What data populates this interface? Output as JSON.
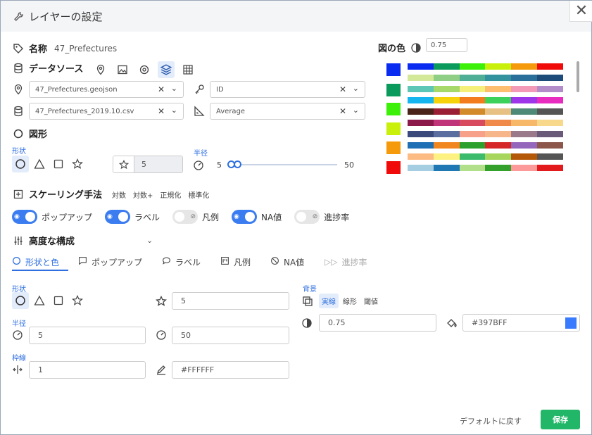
{
  "title": "レイヤーの設定",
  "name": {
    "label": "名称",
    "value": "47_Prefectures"
  },
  "datasource": {
    "label": "データソース"
  },
  "geo_select": {
    "value": "47_Prefectures.geojson"
  },
  "key_select": {
    "value": "ID"
  },
  "csv_select": {
    "value": "47_Prefectures_2019.10.csv"
  },
  "measure_select": {
    "value": "Average"
  },
  "shape_section": {
    "label": "図形",
    "shape_label": "形状",
    "radius_label": "半径",
    "star_value": "5",
    "radius_min": "5",
    "radius_max": "50"
  },
  "scaling": {
    "label": "スケーリング手法",
    "options": [
      "対数",
      "対数+",
      "正規化",
      "標準化"
    ]
  },
  "toggles": [
    {
      "label": "ポップアップ",
      "on": true
    },
    {
      "label": "ラベル",
      "on": true
    },
    {
      "label": "凡例",
      "on": false
    },
    {
      "label": "NA値",
      "on": true
    },
    {
      "label": "進捗率",
      "on": false
    }
  ],
  "advanced": {
    "label": "高度な構成"
  },
  "tabs": [
    {
      "label": "形状と色"
    },
    {
      "label": "ポップアップ"
    },
    {
      "label": "ラベル"
    },
    {
      "label": "凡例"
    },
    {
      "label": "NA値"
    },
    {
      "label": "進捗率"
    }
  ],
  "detail": {
    "shape_label": "形状",
    "star_value": "5",
    "radius_label": "半径",
    "radius_min": "5",
    "radius_max": "50",
    "border_label": "枠線",
    "border_width": "1",
    "border_color": "#FFFFFF",
    "background_label": "背景",
    "bg_options": [
      "実線",
      "線形",
      "閾値"
    ],
    "opacity": "0.75",
    "fill_color": "#397BFF"
  },
  "colors_panel": {
    "label": "図の色",
    "opacity": "0.75",
    "selected_swatches": [
      "#0a2bf0",
      "#0a9a5c",
      "#3cf00a",
      "#c8f00a",
      "#f59a0a",
      "#f00a0a"
    ],
    "palettes": [
      [
        "#0a2bf0",
        "#0a9a5c",
        "#3cf00a",
        "#c8f00a",
        "#f59a0a",
        "#f00a0a"
      ],
      [
        "#d4e89a",
        "#8fcf85",
        "#4fae96",
        "#32939f",
        "#2a6f9b",
        "#1d4b7a"
      ],
      [
        "#5cc7b7",
        "#a6d96a",
        "#f6f07a",
        "#fdbf6f",
        "#f49ab9",
        "#b28dc9"
      ],
      [
        "#15b6f0",
        "#f5d20a",
        "#f37c1e",
        "#3cd15a",
        "#9d35e8",
        "#e82cc0"
      ],
      [
        "#4a2418",
        "#9b1f34",
        "#d28a2a",
        "#e6c183",
        "#4f8a78",
        "#555555"
      ],
      [
        "#8b1a4a",
        "#c0347a",
        "#d84a5e",
        "#ef8a4a",
        "#f7b86a",
        "#f8d88a"
      ],
      [
        "#3a4a7a",
        "#5a6fa0",
        "#f7a08a",
        "#f7b58a",
        "#9a7a8a",
        "#6a5a7a"
      ],
      [
        "#1f6fb4",
        "#f2861e",
        "#2ca02c",
        "#d62728",
        "#9467bd",
        "#8c564b"
      ],
      [
        "#fdbb84",
        "#fdf281",
        "#3dbb6c",
        "#a6d65b",
        "#b35806",
        "#555555"
      ],
      [
        "#a6cee3",
        "#1f78b4",
        "#b2df8a",
        "#33a02c",
        "#fb9a99",
        "#e31a1c"
      ]
    ]
  },
  "footer": {
    "reset": "デフォルトに戻す",
    "save": "保存"
  }
}
